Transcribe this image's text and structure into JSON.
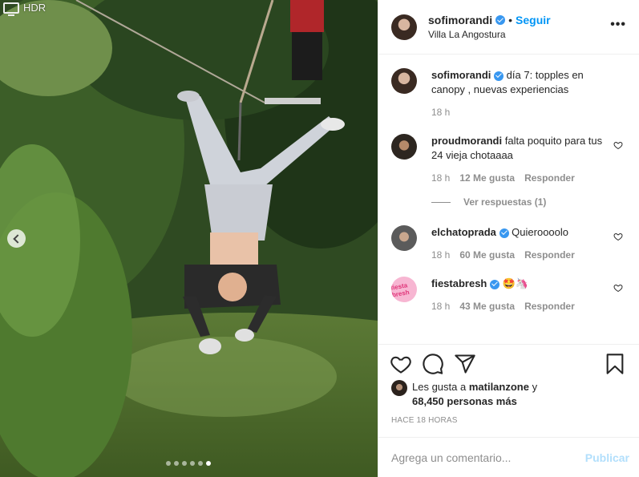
{
  "photo": {
    "hdr_label": "HDR",
    "carousel_total": 6,
    "carousel_active": 6
  },
  "header": {
    "username": "sofimorandi",
    "separator": "•",
    "follow_label": "Seguir",
    "location": "Villa La Angostura",
    "more_label": "•••"
  },
  "caption": {
    "username": "sofimorandi",
    "text": "día 7: topples en canopy , nuevas experiencias",
    "time": "18 h"
  },
  "comments": [
    {
      "username": "proudmorandi",
      "text": "falta poquito para tus 24 vieja chotaaaa",
      "time": "18 h",
      "likes": "12 Me gusta",
      "reply_label": "Responder"
    },
    {
      "username": "elchatoprada",
      "text": "Quieroooolo",
      "time": "18 h",
      "likes": "60 Me gusta",
      "reply_label": "Responder"
    },
    {
      "username": "fiestabresh",
      "text": "🤩🦄",
      "time": "18 h",
      "likes": "43 Me gusta",
      "reply_label": "Responder"
    }
  ],
  "view_replies": "Ver respuestas (1)",
  "fiestabresh_avatar_text": "fiesta bresh",
  "likes": {
    "prefix": "Les gusta a",
    "liker": "matilanzone",
    "conj": "y",
    "others": "68,450 personas más"
  },
  "post_age": "HACE 18 HORAS",
  "add_comment": {
    "placeholder": "Agrega un comentario...",
    "value": "",
    "publish_label": "Publicar"
  },
  "icons": {
    "like": "heart-icon",
    "comment": "comment-icon",
    "share": "paper-plane-icon",
    "save": "bookmark-icon",
    "verified": "verified-badge-icon"
  },
  "colors": {
    "accent": "#0095f6",
    "verified": "#3897f0",
    "muted": "#8e8e8e",
    "publish_disabled": "#b2dffc"
  }
}
